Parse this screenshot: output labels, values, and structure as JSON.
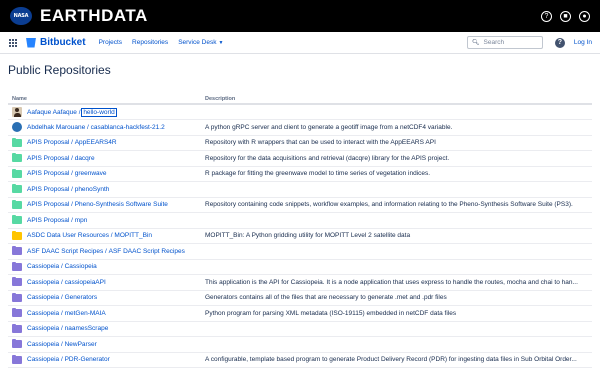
{
  "header": {
    "logo_text": "NASA",
    "brand_bold": "EARTH",
    "brand_rest": "DATA",
    "icons": [
      "help-icon",
      "notification-icon",
      "user-icon"
    ]
  },
  "bitbucket": {
    "app_name": "Bitbucket",
    "nav": [
      "Projects",
      "Repositories",
      "Service Desk"
    ],
    "search_placeholder": "Search",
    "help_glyph": "?",
    "login_label": "Log In"
  },
  "page": {
    "title": "Public Repositories",
    "columns": {
      "name": "Name",
      "description": "Description"
    }
  },
  "repos": [
    {
      "project": "Aafaque Aafaque",
      "repo": "hello-world",
      "desc": "",
      "avatar": "user",
      "color": "#d8c9b3"
    },
    {
      "project": "Abdelhak Marouane",
      "repo": "casablanca-hackfest-21.2",
      "desc": "A python gRPC server and client to generate a geotiff image from a netCDF4 variable.",
      "avatar": "round",
      "color": "#2a6fb3"
    },
    {
      "project": "APIS Proposal",
      "repo": "AppEEARS4R",
      "desc": "Repository with R wrappers that can be used to interact with the AppEEARS API",
      "avatar": "folder",
      "color": "#57d9a3"
    },
    {
      "project": "APIS Proposal",
      "repo": "dacqre",
      "desc": "Repository for the data acquisitions and retrieval (dacqre) library for the APIS project.",
      "avatar": "folder",
      "color": "#57d9a3"
    },
    {
      "project": "APIS Proposal",
      "repo": "greenwave",
      "desc": "R package for fitting the greenwave model to time series of vegetation indices.",
      "avatar": "folder",
      "color": "#57d9a3"
    },
    {
      "project": "APIS Proposal",
      "repo": "phenoSynth",
      "desc": "",
      "avatar": "folder",
      "color": "#57d9a3"
    },
    {
      "project": "APIS Proposal",
      "repo": "Pheno-Synthesis Software Suite",
      "desc": "Repository containing code snippets, workflow examples, and information relating to the Pheno-Synthesis Software Suite (PS3).",
      "avatar": "folder",
      "color": "#57d9a3"
    },
    {
      "project": "APIS Proposal",
      "repo": "mpn",
      "desc": "",
      "avatar": "folder",
      "color": "#57d9a3"
    },
    {
      "project": "ASDC Data User Resources",
      "repo": "MOPITT_Bin",
      "desc": "MOPITT_Bin: A Python gridding utility for MOPITT Level 2 satellite data",
      "avatar": "folder",
      "color": "#ffc400"
    },
    {
      "project": "ASF DAAC Script Recipes",
      "repo": "ASF DAAC Script Recipes",
      "desc": "",
      "avatar": "folder",
      "color": "#8777d9"
    },
    {
      "project": "Cassiopeia",
      "repo": "Cassiopeia",
      "desc": "",
      "avatar": "folder",
      "color": "#8777d9"
    },
    {
      "project": "Cassiopeia",
      "repo": "cassiopeiaAPI",
      "desc": "This application is the API for Cassiopeia. It is a node application that uses express to handle the routes, mocha and chai to han...",
      "avatar": "folder",
      "color": "#8777d9"
    },
    {
      "project": "Cassiopeia",
      "repo": "Generators",
      "desc": "Generators contains all of the files that are necessary to generate .met and .pdr files",
      "avatar": "folder",
      "color": "#8777d9"
    },
    {
      "project": "Cassiopeia",
      "repo": "metGen-MAIA",
      "desc": "Python program for parsing XML metadata (ISO-19115) embedded in netCDF data files",
      "avatar": "folder",
      "color": "#8777d9"
    },
    {
      "project": "Cassiopeia",
      "repo": "naamesScrape",
      "desc": "",
      "avatar": "folder",
      "color": "#8777d9"
    },
    {
      "project": "Cassiopeia",
      "repo": "NewParser",
      "desc": "",
      "avatar": "folder",
      "color": "#8777d9"
    },
    {
      "project": "Cassiopeia",
      "repo": "PDR-Generator",
      "desc": "A configurable, template based program to generate Product Delivery Record (PDR) for ingesting data files in Sub Orbital Order...",
      "avatar": "folder",
      "color": "#8777d9"
    }
  ]
}
